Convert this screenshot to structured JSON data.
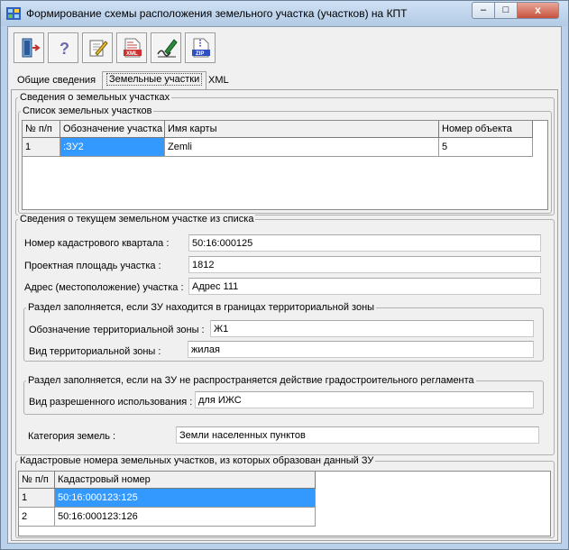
{
  "window": {
    "title": "Формирование схемы расположения земельного участка (участков) на КПТ",
    "close_glyph": "x",
    "min_glyph": "–",
    "max_glyph": "□"
  },
  "toolbar": [
    {
      "name": "exit-button",
      "icon": "door-exit-icon"
    },
    {
      "name": "help-button",
      "icon": "help-icon"
    },
    {
      "name": "edit-button",
      "icon": "edit-pencil-icon"
    },
    {
      "name": "xml-export-button",
      "icon": "xml-file-icon",
      "caption": "XML"
    },
    {
      "name": "sign-button",
      "icon": "signature-pen-icon"
    },
    {
      "name": "zip-export-button",
      "icon": "zip-file-icon",
      "caption": "ZIP"
    }
  ],
  "tabs": [
    {
      "label": "Общие сведения",
      "active": false
    },
    {
      "label": "Земельные участки",
      "active": true
    },
    {
      "label": "XML",
      "active": false
    }
  ],
  "parcels_group": {
    "legend": "Сведения о земельных участках",
    "list_legend": "Список земельных участков",
    "columns": [
      "№ п/п",
      "Обозначение участка",
      "Имя карты",
      "Номер объекта"
    ],
    "rows": [
      [
        "1",
        ":ЗУ2",
        "Zemli",
        "5"
      ]
    ]
  },
  "current_group": {
    "legend": "Сведения о текущем земельном участке из списка",
    "quarter_label": "Номер кадастрового квартала :",
    "quarter_value": "50:16:000125",
    "area_label": "Проектная площадь участка :",
    "area_value": "1812",
    "address_label": "Адрес (местоположение) участка :",
    "address_value": "Адрес 111",
    "zone_group": {
      "legend": "Раздел заполняется, если ЗУ находится в границах территориальной зоны",
      "zone_code_label": "Обозначение территориальной зоны :",
      "zone_code_value": "Ж1",
      "zone_type_label": "Вид территориальной зоны :",
      "zone_type_value": "жилая"
    },
    "reg_group": {
      "legend": "Раздел заполняется, если на ЗУ не распространяется действие градостроительного регламента",
      "use_label": "Вид разрешенного использования :",
      "use_value": "для ИЖС"
    },
    "category_label": "Категория земель :",
    "category_value": "Земли населенных пунктов"
  },
  "cadastral_group": {
    "legend": "Кадастровые номера земельных участков, из которых образован данный ЗУ",
    "columns": [
      "№ п/п",
      "Кадастровый номер"
    ],
    "rows": [
      [
        "1",
        "50:16:000123:125"
      ],
      [
        "2",
        "50:16:000123:126"
      ]
    ]
  },
  "colors": {
    "selection": "#3399ff",
    "window_frame": "#b9d1ea"
  }
}
